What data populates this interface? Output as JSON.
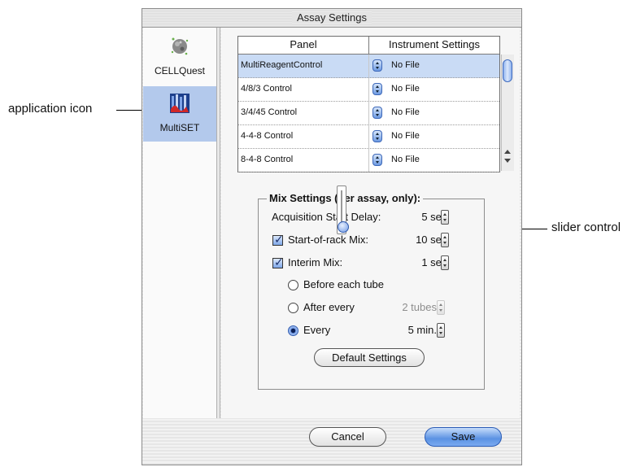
{
  "callouts": {
    "application_icon": "application icon",
    "slider_control": "slider control"
  },
  "window": {
    "title": "Assay Settings"
  },
  "sidebar": {
    "items": [
      {
        "label": "CELLQuest",
        "icon": "cellquest-app-icon",
        "selected": false
      },
      {
        "label": "MultiSET",
        "icon": "multiset-app-icon",
        "selected": true
      }
    ]
  },
  "table": {
    "headers": [
      "Panel",
      "Instrument Settings"
    ],
    "rows": [
      {
        "panel": "MultiReagentControl",
        "setting": "No File",
        "selected": true
      },
      {
        "panel": "4/8/3 Control",
        "setting": "No File"
      },
      {
        "panel": "3/4/45 Control",
        "setting": "No File"
      },
      {
        "panel": "4-4-8 Control",
        "setting": "No File"
      },
      {
        "panel": "8-4-8 Control",
        "setting": "No File"
      }
    ]
  },
  "mix_settings": {
    "title": "Mix Settings (per assay, only):",
    "acquisition_delay": {
      "label": "Acquisition Start Delay:",
      "value": "5 sec."
    },
    "start_of_rack": {
      "label": "Start-of-rack Mix:",
      "value": "10 sec.",
      "checked": true
    },
    "interim": {
      "label": "Interim Mix:",
      "value": "1 sec.",
      "checked": true
    },
    "options": {
      "before_each": {
        "label": "Before each tube",
        "selected": false
      },
      "after_every": {
        "label": "After every",
        "value": "2 tubes",
        "selected": false,
        "enabled": false
      },
      "every": {
        "label": "Every",
        "value": "5 min.",
        "selected": true
      }
    },
    "default_button": "Default Settings"
  },
  "buttons": {
    "cancel": "Cancel",
    "save": "Save"
  },
  "colors": {
    "selection": "#b3c9ec",
    "accent": "#5b92e3"
  }
}
